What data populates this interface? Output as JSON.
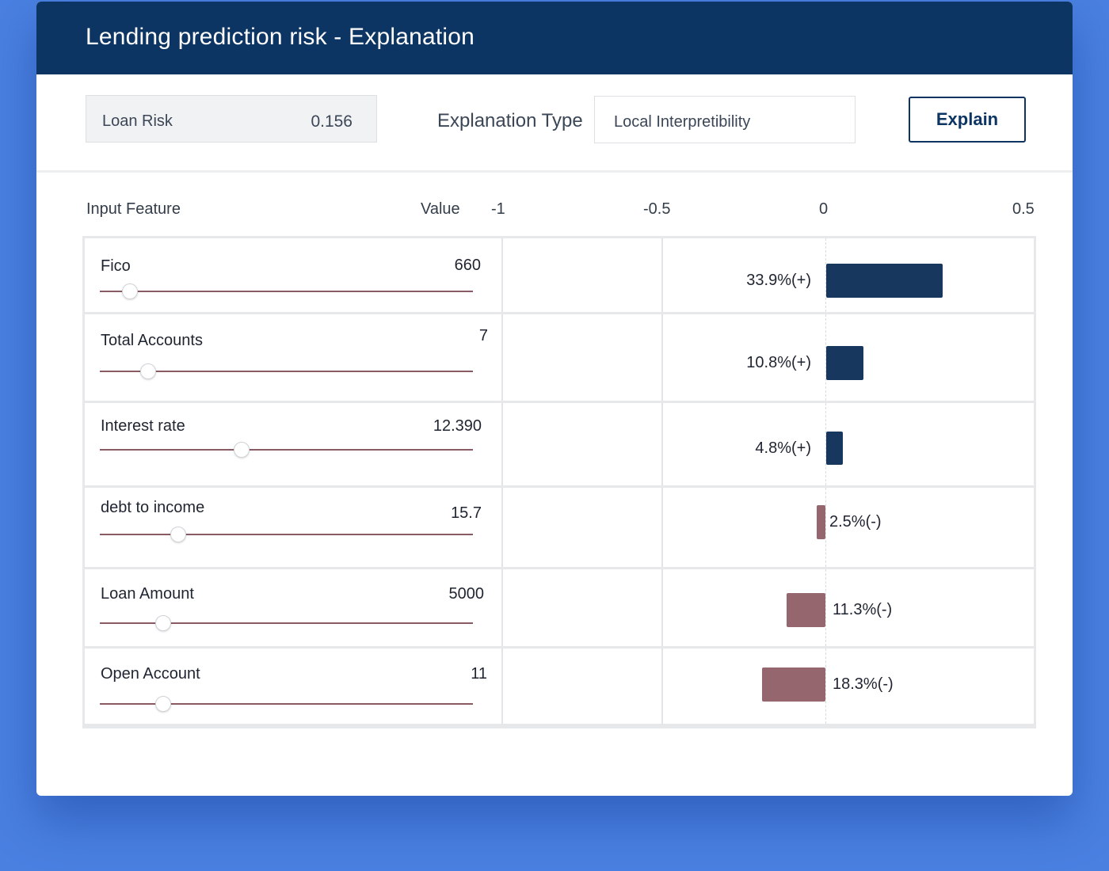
{
  "app": {
    "title": "Lending prediction risk - Explanation"
  },
  "controls": {
    "risk_label": "Loan Risk",
    "risk_value": "0.156",
    "type_label": "Explanation Type",
    "type_value": "Local Interpretibility",
    "explain_label": "Explain"
  },
  "table": {
    "headers": {
      "feature": "Input Feature",
      "value": "Value"
    },
    "axis_ticks": [
      "-1",
      "-0.5",
      "0",
      "0.5"
    ],
    "rows": [
      {
        "name": "Fico",
        "value": "660",
        "slider": 0.08,
        "contribution": 0.339,
        "label": "33.9%(+)",
        "sign": "pos"
      },
      {
        "name": "Total Accounts",
        "value": "7",
        "slider": 0.13,
        "contribution": 0.108,
        "label": "10.8%(+)",
        "sign": "pos"
      },
      {
        "name": "Interest rate",
        "value": "12.390",
        "slider": 0.38,
        "contribution": 0.048,
        "label": "4.8%(+)",
        "sign": "pos"
      },
      {
        "name": "debt to income",
        "value": "15.7",
        "slider": 0.21,
        "contribution": -0.025,
        "label": "2.5%(-)",
        "sign": "neg"
      },
      {
        "name": "Loan Amount",
        "value": "5000",
        "slider": 0.17,
        "contribution": -0.113,
        "label": "11.3%(-)",
        "sign": "neg"
      },
      {
        "name": "Open Account",
        "value": "11",
        "slider": 0.17,
        "contribution": -0.183,
        "label": "18.3%(-)",
        "sign": "neg"
      }
    ]
  },
  "colors": {
    "header_bg": "#0d3563",
    "positive_bar": "#17375f",
    "negative_bar": "#96666f",
    "page_bg": "#4a80e0"
  }
}
